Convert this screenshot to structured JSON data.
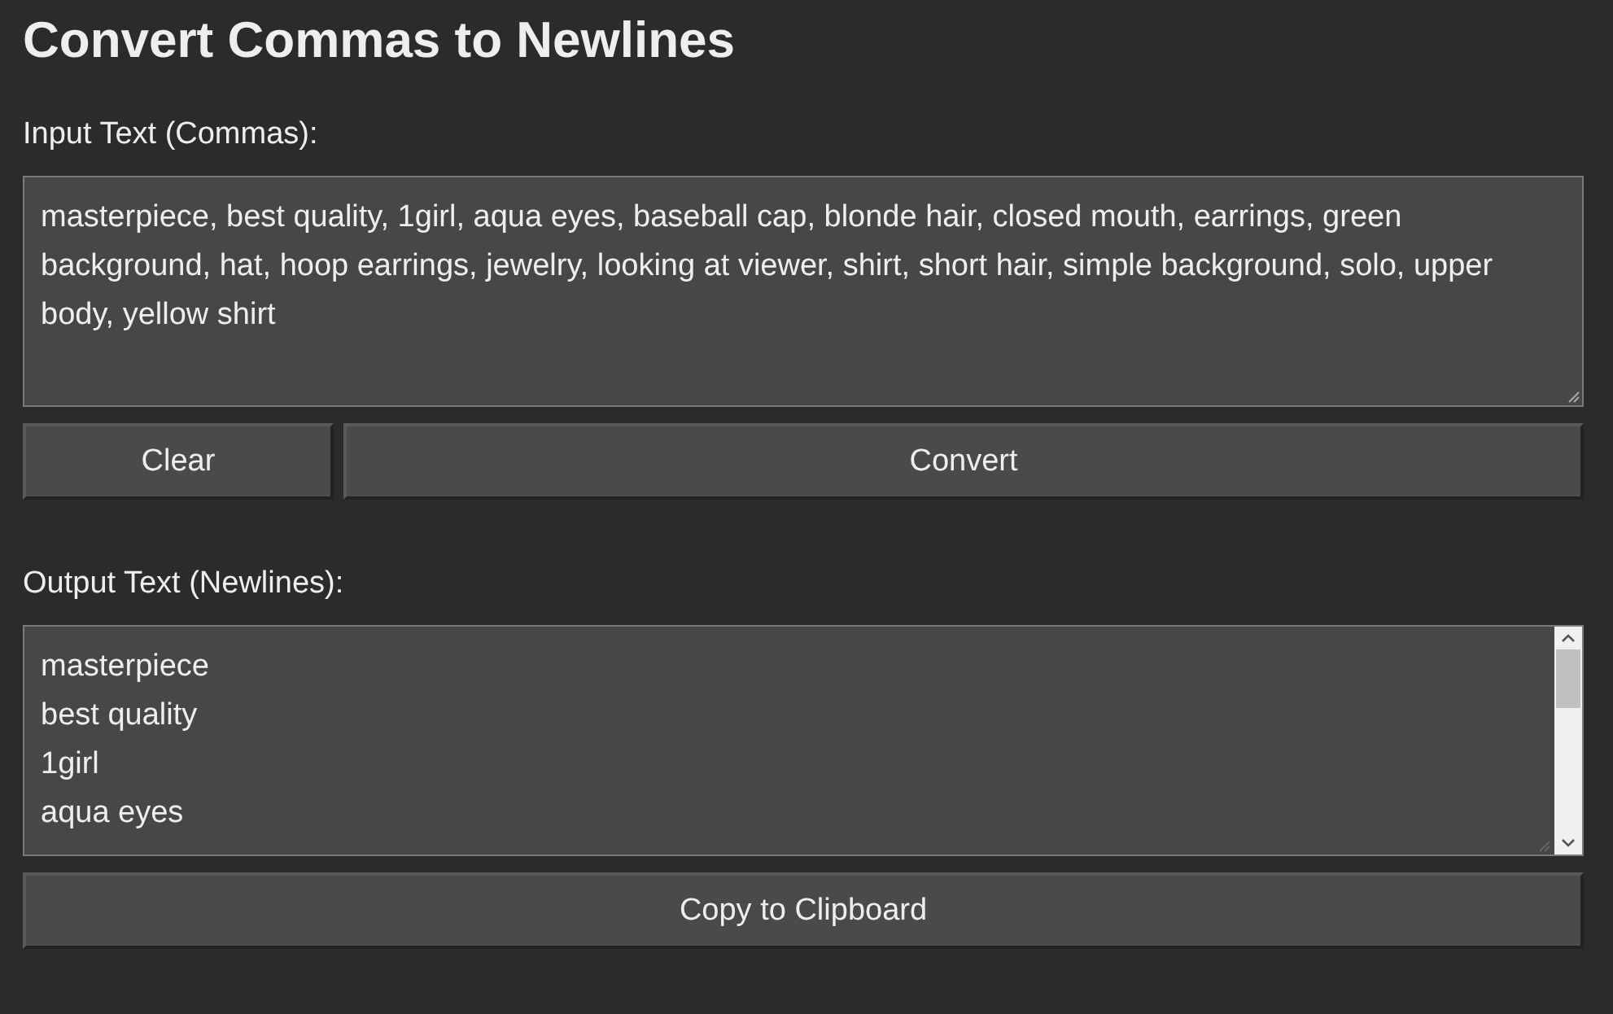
{
  "title": "Convert Commas to Newlines",
  "input": {
    "label": "Input Text (Commas):",
    "value": "masterpiece, best quality, 1girl, aqua eyes, baseball cap, blonde hair, closed mouth, earrings, green background, hat, hoop earrings, jewelry, looking at viewer, shirt, short hair, simple background, solo, upper body, yellow shirt"
  },
  "buttons": [
    "Clear",
    "Convert"
  ],
  "output": {
    "label": "Output Text (Newlines):",
    "lines": [
      "masterpiece",
      "best quality",
      "1girl",
      "aqua eyes"
    ]
  },
  "copy_button": "Copy to Clipboard"
}
